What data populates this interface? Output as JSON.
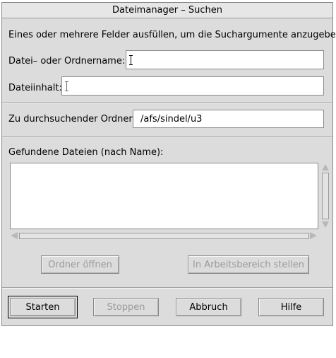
{
  "window": {
    "title": "Dateimanager – Suchen"
  },
  "instructions": "Eines oder mehrere Felder ausfüllen, um die Suchargumente anzugeben:",
  "fields": {
    "name_label": "Datei– oder Ordnername:",
    "name_value": "",
    "content_label": "Dateiinhalt:",
    "content_value": "",
    "folder_label": "Zu durchsuchender Ordner:",
    "folder_value": "/afs/sindel/u3"
  },
  "results": {
    "label": "Gefundene Dateien (nach Name):",
    "items": []
  },
  "result_actions": {
    "open_folder": "Ordner öffnen",
    "put_in_workspace": "In Arbeitsbereich stellen"
  },
  "buttons": {
    "start": "Starten",
    "stop": "Stoppen",
    "cancel": "Abbruch",
    "help": "Hilfe"
  }
}
